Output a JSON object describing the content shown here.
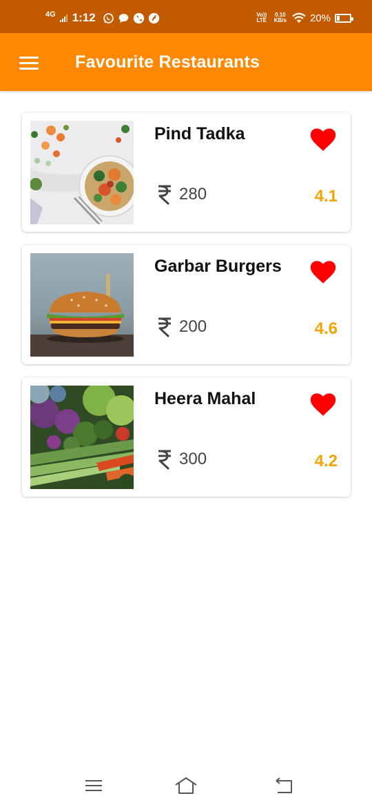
{
  "status_bar": {
    "network": "4G",
    "time": "1:12",
    "notification_icons": [
      "whatsapp-icon",
      "message-icon",
      "phone-icon",
      "app-icon"
    ],
    "volte_top": "Vo))",
    "volte_bottom": "LTE",
    "speed_value": "0.10",
    "speed_unit": "KB/s",
    "battery_percent": "20%",
    "battery_level": 0.2
  },
  "app_bar": {
    "title": "Favourite Restaurants",
    "menu_icon": "hamburger-menu-icon"
  },
  "restaurants": [
    {
      "name": "Pind Tadka",
      "price": "280",
      "rating": "4.1",
      "favourite": true
    },
    {
      "name": "Garbar Burgers",
      "price": "200",
      "rating": "4.6",
      "favourite": true
    },
    {
      "name": "Heera Mahal",
      "price": "300",
      "rating": "4.2",
      "favourite": true
    }
  ],
  "nav_bar": {
    "icons": [
      "recent-apps-icon",
      "home-icon",
      "back-icon"
    ]
  },
  "colors": {
    "status_bar": "#c25a00",
    "app_bar": "#ff8800",
    "heart": "#ff0000",
    "rating": "#f5a300"
  }
}
